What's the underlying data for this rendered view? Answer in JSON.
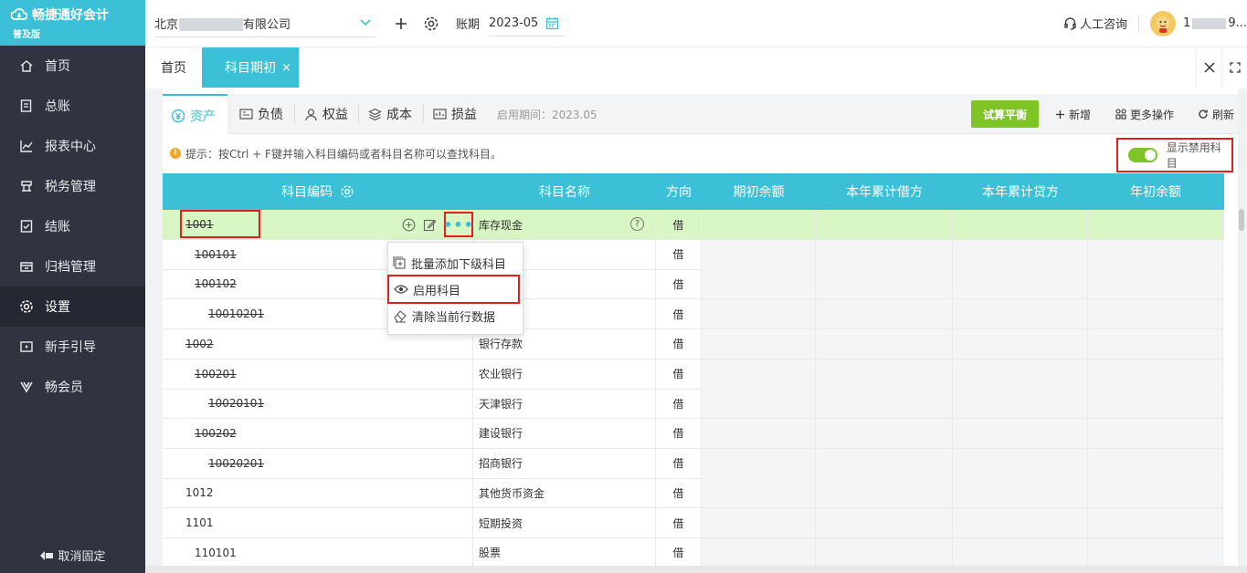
{
  "app": {
    "name": "畅捷通好会计",
    "edition": "普及版"
  },
  "sidebar": {
    "items": [
      {
        "label": "首页",
        "icon": "home-icon"
      },
      {
        "label": "总账",
        "icon": "ledger-icon"
      },
      {
        "label": "报表中心",
        "icon": "chart-icon"
      },
      {
        "label": "税务管理",
        "icon": "tax-icon"
      },
      {
        "label": "结账",
        "icon": "closing-icon"
      },
      {
        "label": "归档管理",
        "icon": "archive-icon"
      },
      {
        "label": "设置",
        "icon": "gear-icon"
      },
      {
        "label": "新手引导",
        "icon": "video-icon"
      },
      {
        "label": "畅会员",
        "icon": "vip-icon"
      }
    ],
    "active_index": 6,
    "unpin_label": "取消固定"
  },
  "topbar": {
    "company_prefix": "北京",
    "company_suffix": "有限公司",
    "period_label": "账期",
    "period_value": "2023-05",
    "consult_label": "人工咨询",
    "user_prefix": "1",
    "user_suffix": "9..."
  },
  "tabs": {
    "home": "首页",
    "active": "科目期初",
    "close_glyph": "×"
  },
  "subtabs": [
    {
      "label": "资产",
      "icon": "asset-icon",
      "active": true
    },
    {
      "label": "负债",
      "icon": "liability-icon",
      "active": false
    },
    {
      "label": "权益",
      "icon": "equity-icon",
      "active": false
    },
    {
      "label": "成本",
      "icon": "cost-icon",
      "active": false
    },
    {
      "label": "损益",
      "icon": "profit-loss-icon",
      "active": false
    }
  ],
  "toolbar": {
    "enable_period": "启用期间：2023.05",
    "trial_balance": "试算平衡",
    "add": "新增",
    "more_ops": "更多操作",
    "refresh": "刷新"
  },
  "tip": {
    "text": "提示：按Ctrl + F键并输入科目编码或者科目名称可以查找科目。",
    "show_disabled_label": "显示禁用科目",
    "show_disabled_on": true
  },
  "table": {
    "headers": {
      "code": "科目编码",
      "name": "科目名称",
      "direction": "方向",
      "opening": "期初余额",
      "ytd_debit": "本年累计借方",
      "ytd_credit": "本年累计贷方",
      "year_start": "年初余额"
    },
    "rows": [
      {
        "code": "1001",
        "name": "库存现金",
        "dir": "借",
        "level": 1,
        "disabled": true,
        "highlight": true
      },
      {
        "code": "100101",
        "name": "",
        "dir": "借",
        "level": 2,
        "disabled": true,
        "highlight": false
      },
      {
        "code": "100102",
        "name": "",
        "dir": "借",
        "level": 2,
        "disabled": true,
        "highlight": false
      },
      {
        "code": "10010201",
        "name": "",
        "dir": "借",
        "level": 3,
        "disabled": true,
        "highlight": false
      },
      {
        "code": "1002",
        "name": "银行存款",
        "dir": "借",
        "level": 1,
        "disabled": true,
        "highlight": false
      },
      {
        "code": "100201",
        "name": "农业银行",
        "dir": "借",
        "level": 2,
        "disabled": true,
        "highlight": false
      },
      {
        "code": "10020101",
        "name": "天津银行",
        "dir": "借",
        "level": 3,
        "disabled": true,
        "highlight": false
      },
      {
        "code": "100202",
        "name": "建设银行",
        "dir": "借",
        "level": 2,
        "disabled": true,
        "highlight": false
      },
      {
        "code": "10020201",
        "name": "招商银行",
        "dir": "借",
        "level": 3,
        "disabled": true,
        "highlight": false
      },
      {
        "code": "1012",
        "name": "其他货币资金",
        "dir": "借",
        "level": 1,
        "disabled": false,
        "highlight": false
      },
      {
        "code": "1101",
        "name": "短期投资",
        "dir": "借",
        "level": 1,
        "disabled": false,
        "highlight": false
      },
      {
        "code": "110101",
        "name": "股票",
        "dir": "借",
        "level": 2,
        "disabled": false,
        "highlight": false
      }
    ],
    "more_glyph": "•••",
    "help_glyph": "?"
  },
  "context_menu": {
    "items": [
      {
        "label": "批量添加下级科目",
        "icon": "batch-add-icon"
      },
      {
        "label": "启用科目",
        "icon": "eye-icon"
      },
      {
        "label": "清除当前行数据",
        "icon": "eraser-icon"
      }
    ]
  },
  "colors": {
    "accent": "#3cc0d8",
    "sidebar_bg": "#2f3440",
    "highlight_row": "#d8f5c4",
    "trial_button": "#7ec424",
    "annotation_red": "#e02020"
  }
}
